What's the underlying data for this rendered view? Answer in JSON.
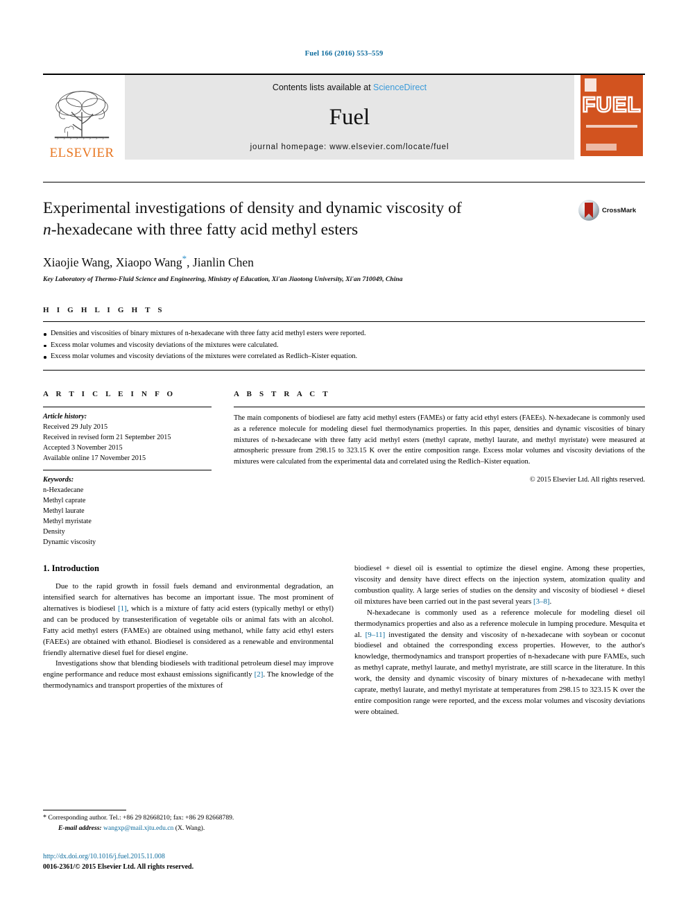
{
  "running_head": "Fuel 166 (2016) 553–559",
  "masthead": {
    "elsevier_wordmark": "ELSEVIER",
    "contents_prefix": "Contents lists available at ",
    "sciencedirect": "ScienceDirect",
    "journal_name": "Fuel",
    "homepage": "journal homepage: www.elsevier.com/locate/fuel",
    "cover_title": "FUEL",
    "sciencedirect_color": "#3a9ad9",
    "elsevier_orange": "#E87722",
    "cover_orange": "#d2531f"
  },
  "article": {
    "title_line1": "Experimental investigations of density and dynamic viscosity of",
    "title_line2_italic": "n",
    "title_line2_rest": "-hexadecane with three fatty acid methyl esters",
    "authors": "Xiaojie Wang, Xiaopo Wang",
    "authors_star": "*",
    "authors_rest": ", Jianlin Chen",
    "affiliation": "Key Laboratory of Thermo-Fluid Science and Engineering, Ministry of Education, Xi'an Jiaotong University, Xi'an 710049, China",
    "crossmark_label": "CrossMark"
  },
  "highlights": {
    "heading": "H I G H L I G H T S",
    "items": [
      "Densities and viscosities of binary mixtures of n-hexadecane with three fatty acid methyl esters were reported.",
      "Excess molar volumes and viscosity deviations of the mixtures were calculated.",
      "Excess molar volumes and viscosity deviations of the mixtures were correlated as Redlich–Kister equation."
    ]
  },
  "article_info": {
    "heading": "A R T I C L E    I N F O",
    "history_label": "Article history:",
    "history": [
      "Received 29 July 2015",
      "Received in revised form 21 September 2015",
      "Accepted 3 November 2015",
      "Available online 17 November 2015"
    ],
    "keywords_label": "Keywords:",
    "keywords": [
      "n-Hexadecane",
      "Methyl caprate",
      "Methyl laurate",
      "Methyl myristate",
      "Density",
      "Dynamic viscosity"
    ]
  },
  "abstract": {
    "heading": "A B S T R A C T",
    "text": "The main components of biodiesel are fatty acid methyl esters (FAMEs) or fatty acid ethyl esters (FAEEs). N-hexadecane is commonly used as a reference molecule for modeling diesel fuel thermodynamics properties. In this paper, densities and dynamic viscosities of binary mixtures of n-hexadecane with three fatty acid methyl esters (methyl caprate, methyl laurate, and methyl myristate) were measured at atmospheric pressure from 298.15 to 323.15 K over the entire composition range. Excess molar volumes and viscosity deviations of the mixtures were calculated from the experimental data and correlated using the Redlich–Kister equation.",
    "copyright": "© 2015 Elsevier Ltd. All rights reserved."
  },
  "introduction": {
    "heading": "1. Introduction",
    "left_paragraph_1_a": "Due to the rapid growth in fossil fuels demand and environmental degradation, an intensified search for alternatives has become an important issue. The most prominent of alternatives is biodiesel ",
    "left_paragraph_1_ref": "[1]",
    "left_paragraph_1_b": ", which is a mixture of fatty acid esters (typically methyl or ethyl) and can be produced by transesterification of vegetable oils or animal fats with an alcohol. Fatty acid methyl esters (FAMEs) are obtained using methanol, while fatty acid ethyl esters (FAEEs) are obtained with ethanol. Biodiesel is considered as a renewable and environmental friendly alternative diesel fuel for diesel engine.",
    "left_paragraph_2_a": "Investigations show that blending biodiesels with traditional petroleum diesel may improve engine performance and reduce most exhaust emissions significantly ",
    "left_paragraph_2_ref": "[2]",
    "left_paragraph_2_b": ". The knowledge of the thermodynamics and transport properties of the mixtures of",
    "right_paragraph_1_a": "biodiesel + diesel oil is essential to optimize the diesel engine. Among these properties, viscosity and density have direct effects on the injection system, atomization quality and combustion quality. A large series of studies on the density and viscosity of biodiesel + diesel oil mixtures have been carried out in the past several years ",
    "right_paragraph_1_ref": "[3–8]",
    "right_paragraph_1_b": ".",
    "right_paragraph_2_a": "N-hexadecane is commonly used as a reference molecule for modeling diesel oil thermodynamics properties and also as a reference molecule in lumping procedure. Mesquita et al. ",
    "right_paragraph_2_ref": "[9–11]",
    "right_paragraph_2_b": " investigated the density and viscosity of n-hexadecane with soybean or coconut biodiesel and obtained the corresponding excess properties. However, to the author's knowledge, thermodynamics and transport properties of n-hexadecane with pure FAMEs, such as methyl caprate, methyl laurate, and methyl myristrate, are still scarce in the literature. In this work, the density and dynamic viscosity of binary mixtures of n-hexadecane with methyl caprate, methyl laurate, and methyl myristate at temperatures from 298.15 to 323.15 K over the entire composition range were reported, and the excess molar volumes and viscosity deviations were obtained."
  },
  "footer": {
    "corresponding_star": "*",
    "corresponding": "Corresponding author. Tel.: +86 29 82668210; fax: +86 29 82668789.",
    "email_label": "E-mail address:",
    "email": "wangxp@mail.xjtu.edu.cn",
    "email_suffix": "(X. Wang).",
    "doi": "http://dx.doi.org/10.1016/j.fuel.2015.11.008",
    "issn": "0016-2361/© 2015 Elsevier Ltd. All rights reserved.",
    "link_color": "#0b6a9c"
  }
}
